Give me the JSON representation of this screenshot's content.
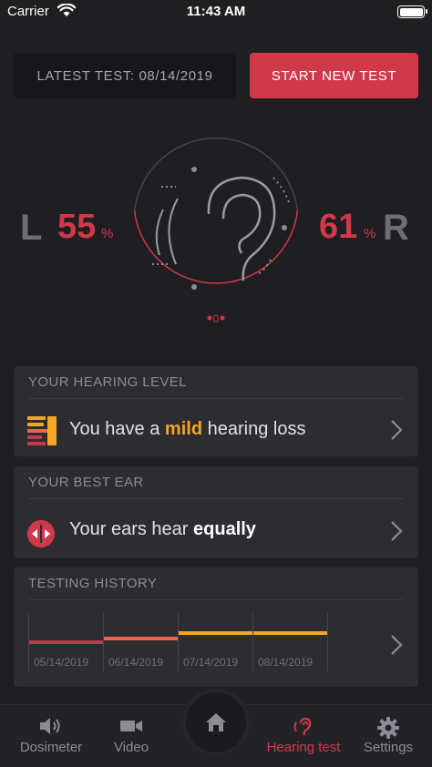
{
  "status_bar": {
    "carrier": "Carrier",
    "time": "11:43 AM"
  },
  "header": {
    "latest_test": "LATEST TEST: 08/14/2019",
    "start_button": "START NEW TEST"
  },
  "dial": {
    "left_letter": "L",
    "right_letter": "R",
    "left_percent": "55",
    "right_percent": "61",
    "percent_sign": "%",
    "zero_label": "0",
    "left_value": 55,
    "right_value": 61
  },
  "hearing_level": {
    "title": "YOUR HEARING LEVEL",
    "text_prefix": "You have a ",
    "text_highlight": "mild",
    "text_suffix": " hearing loss"
  },
  "best_ear": {
    "title": "YOUR BEST EAR",
    "text_prefix": "Your ears hear ",
    "text_highlight": "equally"
  },
  "history": {
    "title": "TESTING HISTORY",
    "entries": [
      {
        "date": "05/14/2019",
        "level": 0.3,
        "color": "#c9374a"
      },
      {
        "date": "06/14/2019",
        "level": 0.4,
        "color": "#e8684e"
      },
      {
        "date": "07/14/2019",
        "level": 0.55,
        "color": "#f5a623"
      },
      {
        "date": "08/14/2019",
        "level": 0.55,
        "color": "#f5a623"
      }
    ]
  },
  "tabs": [
    {
      "label": "Dosimeter",
      "icon": "speaker-icon",
      "active": false
    },
    {
      "label": "Video",
      "icon": "video-camera-icon",
      "active": false
    },
    {
      "label": "",
      "icon": "home-icon",
      "active": false
    },
    {
      "label": "Hearing test",
      "icon": "ear-icon",
      "active": true
    },
    {
      "label": "Settings",
      "icon": "gear-icon",
      "active": false
    }
  ],
  "colors": {
    "accent": "#d0394a",
    "orange": "#f5a623",
    "background": "#1f1f22",
    "card": "#2c2c31"
  }
}
